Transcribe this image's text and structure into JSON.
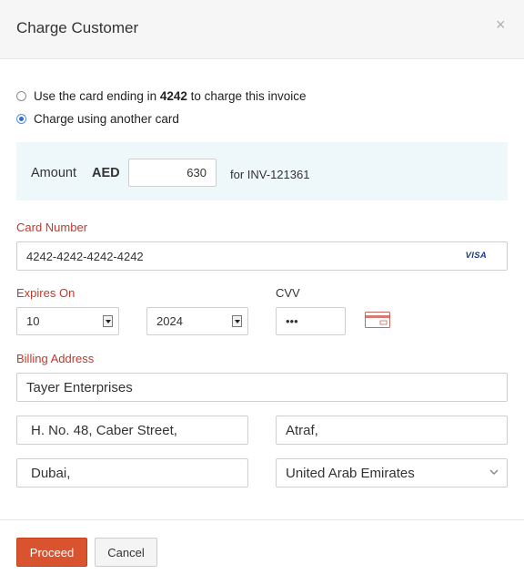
{
  "modal": {
    "title": "Charge Customer",
    "close_glyph": "×"
  },
  "payment_options": {
    "saved_card_prefix": "Use the card ending in",
    "saved_card_last4": "4242",
    "saved_card_suffix": "to charge this invoice",
    "saved_card_selected": false,
    "another_card_label": "Charge using another card",
    "another_card_selected": true
  },
  "amount": {
    "label": "Amount",
    "currency": "AED",
    "value": "630",
    "invoice_text": "for INV-121361"
  },
  "card": {
    "number_label": "Card Number",
    "number_value": "4242-4242-4242-4242",
    "brand": "VISA",
    "expires_label": "Expires On",
    "month": "10",
    "year": "2024",
    "cvv_label": "CVV",
    "cvv_value": "•••",
    "cvv_icon": "credit-card-icon"
  },
  "billing": {
    "label": "Billing Address",
    "address_line1": "Tayer Enterprises",
    "address_line2": "H. No. 48, Caber Street,",
    "city": "Atraf,",
    "state": "Dubai,",
    "country": "United Arab Emirates"
  },
  "actions": {
    "proceed_label": "Proceed",
    "cancel_label": "Cancel"
  },
  "colors": {
    "primary_button": "#d9532f",
    "required_label": "#c0392b",
    "amount_panel": "#eef7fa",
    "radio_selected": "#2f6bd6"
  }
}
